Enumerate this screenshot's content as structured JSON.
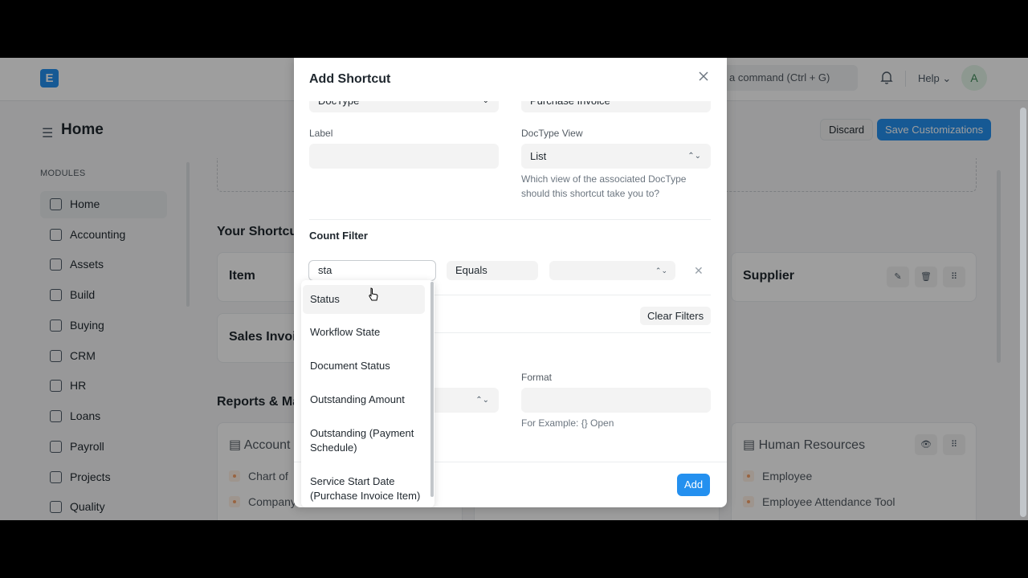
{
  "navbar": {
    "logo_letter": "E",
    "search_placeholder": "a command (Ctrl + G)",
    "help_label": "Help ⌄",
    "avatar_initial": "A",
    "bell_icon": "bell-icon"
  },
  "page": {
    "title": "Home",
    "discard_label": "Discard",
    "save_label": "Save Customizations"
  },
  "sidebar": {
    "section_label": "MODULES",
    "items": [
      {
        "label": "Home",
        "active": true
      },
      {
        "label": "Accounting"
      },
      {
        "label": "Assets"
      },
      {
        "label": "Build"
      },
      {
        "label": "Buying"
      },
      {
        "label": "CRM"
      },
      {
        "label": "HR"
      },
      {
        "label": "Loans"
      },
      {
        "label": "Payroll"
      },
      {
        "label": "Projects"
      },
      {
        "label": "Quality"
      }
    ]
  },
  "main": {
    "shortcuts_heading": "Your Shortcu",
    "shortcut_cards": [
      {
        "label": "Item"
      },
      {
        "label": "Sales Invoic"
      },
      {
        "label": "Supplier"
      }
    ],
    "reports_heading": "Reports & Ma",
    "report_cards": [
      {
        "label": "Account",
        "links": [
          "Chart of",
          "Company"
        ]
      },
      {
        "label": "Human Resources",
        "links": [
          "Employee",
          "Employee Attendance Tool"
        ]
      }
    ]
  },
  "modal": {
    "title": "Add Shortcut",
    "type_value": "DocType",
    "link_to_value": "Purchase Invoice",
    "label_label": "Label",
    "label_value": "",
    "doctype_view_label": "DocType View",
    "doctype_view_value": "List",
    "doctype_view_help_1": "Which view of the associated DocType",
    "doctype_view_help_2": "should this shortcut take you to?",
    "count_filter_title": "Count Filter",
    "filter_field_value": "sta",
    "filter_condition_value": "Equals",
    "filter_value": "",
    "clear_filters_label": "Clear Filters",
    "format_label": "Format",
    "format_value": "",
    "format_help": "For Example: {} Open",
    "add_label": "Add"
  },
  "dropdown": {
    "items": [
      {
        "label": "Status",
        "active": true
      },
      {
        "label": "Workflow State"
      },
      {
        "label": "Document Status"
      },
      {
        "label": "Outstanding Amount"
      },
      {
        "label_line1": "Outstanding (Payment",
        "label_line2": "Schedule)"
      },
      {
        "label_line1": "Service Start Date",
        "label_line2": "(Purchase Invoice Item)"
      }
    ]
  }
}
